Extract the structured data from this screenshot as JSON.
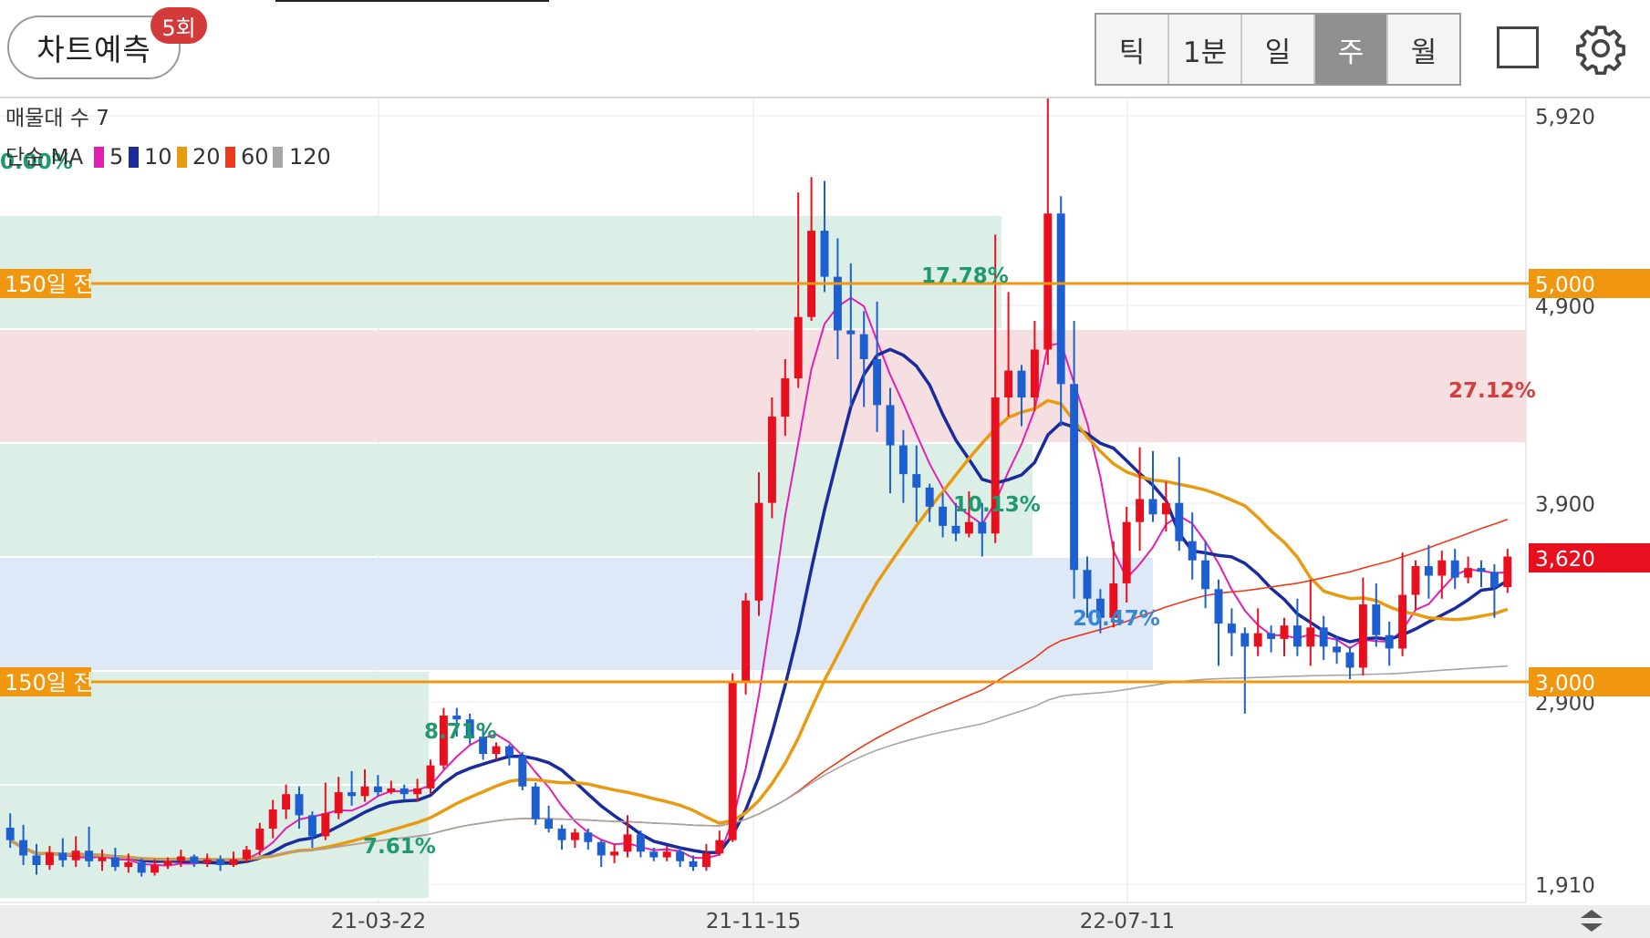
{
  "toolbar": {
    "predict_label": "차트예측",
    "predict_count": "5회",
    "periods": [
      "틱",
      "1분",
      "일",
      "주",
      "월"
    ],
    "active_period": "주",
    "square_icon": "square-icon",
    "settings_icon": "gear-icon"
  },
  "chart_data": {
    "type": "candlestick",
    "volume_profile_label": "매물대 수 7",
    "ma_legend_prefix": "단순 MA",
    "ma_series": [
      {
        "name": "5",
        "color": "#e21fb3"
      },
      {
        "name": "10",
        "color": "#1a2b9e"
      },
      {
        "name": "20",
        "color": "#e89a10"
      },
      {
        "name": "60",
        "color": "#ee3a1c"
      },
      {
        "name": "120",
        "color": "#a6a6a6"
      }
    ],
    "y_axis_ticks": [
      "5,920",
      "4,900",
      "3,900",
      "2,900",
      "1,910"
    ],
    "y_axis_tick_values": [
      5920,
      4900,
      3900,
      2900,
      1910
    ],
    "x_axis_ticks": [
      "21-03-22",
      "21-11-15",
      "22-07-11"
    ],
    "current_price": "3,620",
    "current_price_value": 3620,
    "price_lines": [
      {
        "label": "150일 전",
        "value_label": "5,000",
        "value": 5000
      },
      {
        "label": "150일 전",
        "value_label": "3,000",
        "value": 3000
      }
    ],
    "zone_labels": [
      "0.00%",
      "17.78%",
      "27.12%",
      "10.13%",
      "20.47%",
      "8.71%",
      "7.61%"
    ],
    "colors": {
      "up": "#e8101e",
      "down": "#1d5fd0",
      "line": "#f0960f",
      "current_price": "#e8101e"
    },
    "candles": [
      [
        2205,
        2140,
        2280,
        2100
      ],
      [
        2140,
        2060,
        2220,
        2010
      ],
      [
        2060,
        2010,
        2120,
        1960
      ],
      [
        2010,
        2075,
        2110,
        1985
      ],
      [
        2075,
        2035,
        2150,
        2000
      ],
      [
        2035,
        2085,
        2160,
        2000
      ],
      [
        2085,
        2030,
        2210,
        2000
      ],
      [
        2030,
        2050,
        2090,
        1980
      ],
      [
        2050,
        2000,
        2100,
        1980
      ],
      [
        2000,
        2025,
        2070,
        1970
      ],
      [
        2025,
        1970,
        2045,
        1950
      ],
      [
        1970,
        2010,
        2040,
        1955
      ],
      [
        2010,
        2030,
        2050,
        1990
      ],
      [
        2030,
        2055,
        2090,
        2000
      ],
      [
        2055,
        2020,
        2065,
        2000
      ],
      [
        2020,
        2040,
        2070,
        2000
      ],
      [
        2040,
        2010,
        2060,
        1980
      ],
      [
        2010,
        2040,
        2080,
        2000
      ],
      [
        2040,
        2090,
        2110,
        2020
      ],
      [
        2090,
        2200,
        2230,
        2060
      ],
      [
        2200,
        2300,
        2350,
        2150
      ],
      [
        2300,
        2380,
        2430,
        2250
      ],
      [
        2380,
        2270,
        2420,
        2200
      ],
      [
        2270,
        2160,
        2290,
        2100
      ],
      [
        2160,
        2280,
        2440,
        2140
      ],
      [
        2280,
        2390,
        2470,
        2250
      ],
      [
        2390,
        2370,
        2500,
        2320
      ],
      [
        2370,
        2420,
        2510,
        2340
      ],
      [
        2420,
        2390,
        2480,
        2370
      ],
      [
        2390,
        2410,
        2450,
        2380
      ],
      [
        2410,
        2380,
        2430,
        2350
      ],
      [
        2380,
        2410,
        2460,
        2340
      ],
      [
        2410,
        2530,
        2560,
        2380
      ],
      [
        2530,
        2790,
        2830,
        2510
      ],
      [
        2790,
        2770,
        2830,
        2680
      ],
      [
        2770,
        2680,
        2800,
        2640
      ],
      [
        2680,
        2590,
        2740,
        2560
      ],
      [
        2590,
        2630,
        2650,
        2560
      ],
      [
        2630,
        2580,
        2640,
        2530
      ],
      [
        2580,
        2420,
        2600,
        2400
      ],
      [
        2420,
        2250,
        2440,
        2220
      ],
      [
        2250,
        2200,
        2320,
        2180
      ],
      [
        2200,
        2140,
        2220,
        2090
      ],
      [
        2140,
        2180,
        2200,
        2100
      ],
      [
        2180,
        2130,
        2200,
        2090
      ],
      [
        2130,
        2060,
        2140,
        2000
      ],
      [
        2060,
        2080,
        2120,
        2020
      ],
      [
        2080,
        2170,
        2270,
        2050
      ],
      [
        2170,
        2080,
        2190,
        2050
      ],
      [
        2080,
        2050,
        2100,
        2030
      ],
      [
        2050,
        2080,
        2110,
        2030
      ],
      [
        2080,
        2030,
        2100,
        2000
      ],
      [
        2030,
        2000,
        2060,
        1980
      ],
      [
        2000,
        2070,
        2120,
        1980
      ],
      [
        2070,
        2140,
        2190,
        2060
      ],
      [
        2140,
        2970,
        3010,
        2130
      ],
      [
        2970,
        3390,
        3430,
        2900
      ],
      [
        3390,
        3900,
        4060,
        3310
      ],
      [
        3900,
        4350,
        4450,
        3820
      ],
      [
        4350,
        4550,
        4650,
        4250
      ],
      [
        4550,
        4870,
        5520,
        4500
      ],
      [
        4870,
        5320,
        5600,
        4850
      ],
      [
        5320,
        5080,
        5580,
        5000
      ],
      [
        5080,
        4800,
        5280,
        4650
      ],
      [
        4800,
        4780,
        5150,
        4400
      ],
      [
        4780,
        4650,
        4900,
        4400
      ],
      [
        4650,
        4410,
        4950,
        4270
      ],
      [
        4410,
        4200,
        4500,
        3950
      ],
      [
        4200,
        4050,
        4280,
        3900
      ],
      [
        4050,
        3980,
        4200,
        3800
      ],
      [
        3980,
        3880,
        4000,
        3800
      ],
      [
        3880,
        3780,
        3950,
        3720
      ],
      [
        3780,
        3740,
        3900,
        3700
      ],
      [
        3740,
        3800,
        3960,
        3720
      ],
      [
        3800,
        3740,
        3900,
        3620
      ],
      [
        3740,
        4450,
        5300,
        3690
      ],
      [
        4450,
        4590,
        5000,
        4350
      ],
      [
        4590,
        4450,
        4620,
        4300
      ],
      [
        4450,
        4700,
        4850,
        4380
      ],
      [
        4700,
        5410,
        6310,
        4620
      ],
      [
        5410,
        4520,
        5500,
        4300
      ],
      [
        4520,
        3550,
        4850,
        3400
      ],
      [
        3550,
        3400,
        3620,
        3300
      ],
      [
        3400,
        3300,
        3450,
        3220
      ],
      [
        3300,
        3480,
        3700,
        3250
      ],
      [
        3480,
        3800,
        3880,
        3380
      ],
      [
        3800,
        3920,
        4190,
        3650
      ],
      [
        3920,
        3840,
        4170,
        3800
      ],
      [
        3840,
        3900,
        4010,
        3750
      ],
      [
        3900,
        3700,
        4140,
        3650
      ],
      [
        3700,
        3600,
        3850,
        3500
      ],
      [
        3600,
        3450,
        3700,
        3350
      ],
      [
        3450,
        3270,
        3500,
        3050
      ],
      [
        3270,
        3220,
        3350,
        3100
      ],
      [
        3220,
        3150,
        3250,
        2800
      ],
      [
        3150,
        3220,
        3350,
        3100
      ],
      [
        3220,
        3190,
        3260,
        3120
      ],
      [
        3190,
        3260,
        3300,
        3100
      ],
      [
        3260,
        3150,
        3400,
        3100
      ],
      [
        3150,
        3250,
        3500,
        3050
      ],
      [
        3250,
        3150,
        3310,
        3080
      ],
      [
        3150,
        3120,
        3200,
        3060
      ],
      [
        3120,
        3040,
        3150,
        2980
      ],
      [
        3040,
        3370,
        3510,
        3000
      ],
      [
        3370,
        3210,
        3480,
        3150
      ],
      [
        3210,
        3140,
        3280,
        3050
      ],
      [
        3140,
        3420,
        3640,
        3100
      ],
      [
        3420,
        3570,
        3600,
        3340
      ],
      [
        3570,
        3520,
        3680,
        3400
      ],
      [
        3520,
        3600,
        3650,
        3400
      ],
      [
        3600,
        3510,
        3660,
        3450
      ],
      [
        3510,
        3560,
        3620,
        3480
      ],
      [
        3560,
        3540,
        3600,
        3460
      ],
      [
        3540,
        3460,
        3580,
        3300
      ],
      [
        3460,
        3620,
        3660,
        3430
      ]
    ]
  }
}
